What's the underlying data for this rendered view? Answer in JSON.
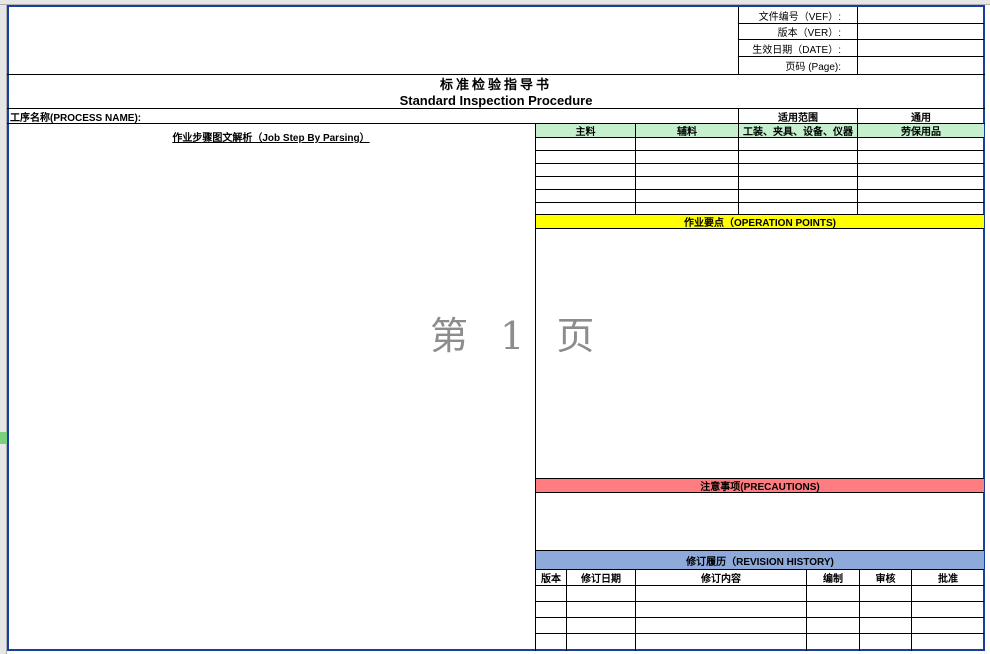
{
  "header_meta": [
    {
      "label": "文件编号（VEF）:",
      "value": ""
    },
    {
      "label": "版本（VER）:",
      "value": ""
    },
    {
      "label": "生效日期（DATE）:",
      "value": ""
    },
    {
      "label": "页码 (Page):",
      "value": ""
    }
  ],
  "title": {
    "cn": "标准检验指导书",
    "en": "Standard Inspection Procedure"
  },
  "process_name_label": "工序名称(PROCESS NAME):",
  "scope": {
    "label": "适用范围",
    "value": "通用"
  },
  "job_step_heading": "作业步骤图文解析（Job Step By Parsing）",
  "materials_table": {
    "headers": [
      "主料",
      "辅料",
      "工装、夹具、设备、仪器",
      "劳保用品"
    ],
    "rows": [
      [
        "",
        "",
        "",
        ""
      ],
      [
        "",
        "",
        "",
        ""
      ],
      [
        "",
        "",
        "",
        ""
      ],
      [
        "",
        "",
        "",
        ""
      ],
      [
        "",
        "",
        "",
        ""
      ],
      [
        "",
        "",
        "",
        ""
      ]
    ]
  },
  "operation_points_heading": "作业要点（OPERATION POINTS)",
  "precautions_heading": "注意事项(PRECAUTIONS)",
  "revision_history": {
    "heading": "修订履历（REVISION HISTORY)",
    "headers": [
      "版本",
      "修订日期",
      "修订内容",
      "编制",
      "审核",
      "批准"
    ],
    "rows": [
      [
        "",
        "",
        "",
        "",
        "",
        ""
      ],
      [
        "",
        "",
        "",
        "",
        "",
        ""
      ],
      [
        "",
        "",
        "",
        "",
        "",
        ""
      ],
      [
        "",
        "",
        "",
        "",
        "",
        ""
      ]
    ]
  },
  "watermark": "第 1 页",
  "colors": {
    "materials_header": "#c6efce",
    "operation_points": "#ffff00",
    "precautions": "#ff7c80",
    "revision_history": "#8eaadb",
    "sheet_border": "#1a3f9a"
  }
}
